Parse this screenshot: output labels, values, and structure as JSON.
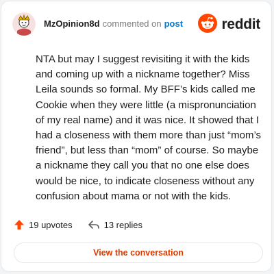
{
  "comment": {
    "username": "MzOpinion8d",
    "action": "commented on",
    "target": "post",
    "body": "NTA but may I suggest revisiting it with the kids and coming up with a nickname together? Miss Leila sounds so formal. My BFF’s kids called me Cookie when they were little (a mispronunciation of my real name) and it was nice. It showed that I had a closeness with them more than just “mom’s friend”, but less than “mom” of course. So maybe a nickname they call you that no one else does would be nice, to indicate closeness without any confusion about mama or not with the kids."
  },
  "brand": {
    "name": "reddit",
    "icon": "reddit-logo-icon",
    "color": "#ff4500"
  },
  "stats": {
    "upvotes_label": "19 upvotes",
    "replies_label": "13 replies",
    "upvote_icon": "upvote-arrow-icon",
    "reply_icon": "reply-arrow-icon"
  },
  "cta": {
    "label": "View the conversation"
  },
  "colors": {
    "accent": "#d93a00",
    "link": "#0079d3",
    "upvote": "#ff4500"
  }
}
